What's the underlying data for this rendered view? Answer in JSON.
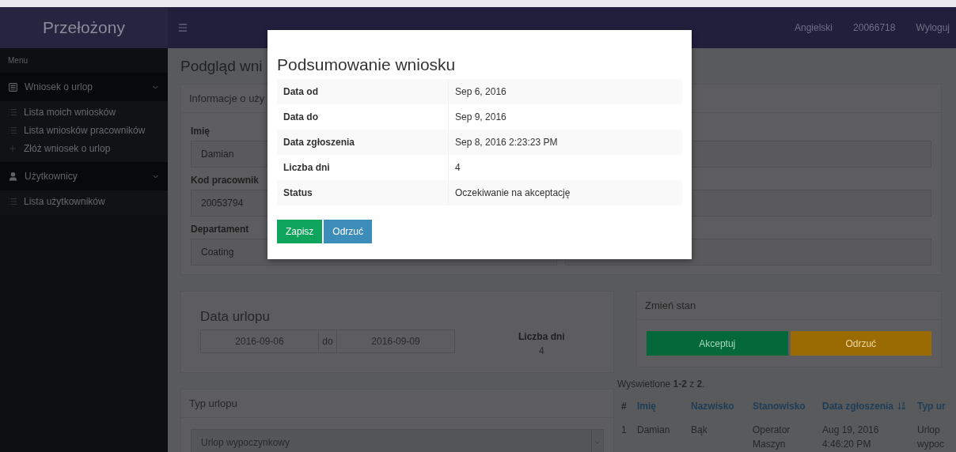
{
  "header": {
    "brand": "Przełożony",
    "links": [
      "Angielski",
      "20066718",
      "Wyloguj"
    ]
  },
  "sidebar": {
    "heading": "Menu",
    "groups": [
      {
        "label": "Wniosek o urlop",
        "kind": "form",
        "expanded": true,
        "children": [
          {
            "label": "Lista moich wniosków",
            "kind": "list"
          },
          {
            "label": "Lista wniosków pracowników",
            "kind": "list"
          },
          {
            "label": "Złóż wniosek o urlop",
            "kind": "plus"
          }
        ]
      },
      {
        "label": "Użytkownicy",
        "kind": "user",
        "expanded": true,
        "children": [
          {
            "label": "Lista użytkowników",
            "kind": "list"
          }
        ]
      }
    ]
  },
  "page_title": "Podgląd wni",
  "user_info": {
    "title": "Informacje o uży",
    "fields": [
      {
        "label": "Imię",
        "value": "Damian"
      },
      {
        "label": "Kod pracownik",
        "value": "20053794"
      },
      {
        "label": "Departament",
        "value": "Coating"
      }
    ]
  },
  "leave_dates": {
    "title": "Data urlopu",
    "from": "2016-09-06",
    "separator": "do",
    "to": "2016-09-09",
    "days_label": "Liczba dni",
    "days_value": "4"
  },
  "leave_type": {
    "title": "Typ urlopu",
    "value": "Urlop wypoczynkowy"
  },
  "change_state": {
    "title": "Zmień stan",
    "buttons": [
      {
        "label": "Akceptuj",
        "kind": "accept"
      },
      {
        "label": "Odrzuć",
        "kind": "reject"
      }
    ]
  },
  "table": {
    "summary": "Wyświetlone **1-2** z **2**.",
    "columns": [
      {
        "label": "#",
        "link": false,
        "sorted": false
      },
      {
        "label": "Imię",
        "link": true,
        "sorted": false
      },
      {
        "label": "Nazwisko",
        "link": true,
        "sorted": false
      },
      {
        "label": "Stanowisko",
        "link": true,
        "sorted": false
      },
      {
        "label": "Data zgłoszenia",
        "link": true,
        "sorted": true
      },
      {
        "label": "Typ ur",
        "link": true,
        "sorted": false
      }
    ],
    "rows": [
      [
        "1",
        "Damian",
        "Bąk",
        "Operator Maszyn",
        "Aug 19, 2016 4:46:20 PM",
        "Urlop wypoc"
      ]
    ]
  },
  "modal": {
    "title": "Podsumowanie wniosku",
    "rows": [
      {
        "label": "Data od",
        "value": "Sep 6, 2016"
      },
      {
        "label": "Data do",
        "value": "Sep 9, 2016"
      },
      {
        "label": "Data zgłoszenia",
        "value": "Sep 8, 2016 2:23:23 PM"
      },
      {
        "label": "Liczba dni",
        "value": "4"
      },
      {
        "label": "Status",
        "value": "Oczekiwanie na akceptację"
      }
    ],
    "buttons": [
      {
        "label": "Zapisz",
        "kind": "save"
      },
      {
        "label": "Odrzuć",
        "kind": "reject"
      }
    ]
  }
}
